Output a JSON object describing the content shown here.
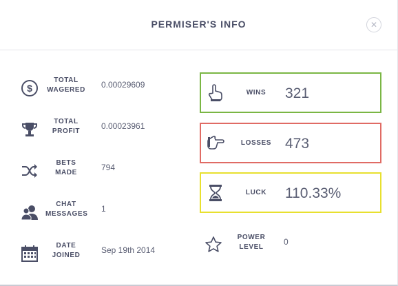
{
  "modal": {
    "title": "PERMISER'S INFO",
    "close_symbol": "✕"
  },
  "stats": [
    {
      "label": "TOTAL\nWAGERED",
      "value": "0.00029609",
      "icon": "dollar-coin-icon"
    },
    {
      "label": "TOTAL\nPROFIT",
      "value": "0.00023961",
      "icon": "trophy-icon"
    },
    {
      "label": "BETS\nMADE",
      "value": "794",
      "icon": "shuffle-icon"
    },
    {
      "label": "CHAT\nMESSAGES",
      "value": "1",
      "icon": "users-icon"
    },
    {
      "label": "DATE\nJOINED",
      "value": "Sep 19th 2014",
      "icon": "calendar-icon"
    }
  ],
  "summary": {
    "wins": {
      "label": "WINS",
      "value": "321",
      "icon": "thumbs-up-hand-icon",
      "border_color": "#7ab644"
    },
    "losses": {
      "label": "LOSSES",
      "value": "473",
      "icon": "thumbs-down-hand-icon",
      "border_color": "#e06b64"
    },
    "luck": {
      "label": "LUCK",
      "value": "110.33%",
      "icon": "hourglass-icon",
      "border_color": "#e8e02e"
    },
    "power_level": {
      "label": "POWER\nLEVEL",
      "value": "0",
      "icon": "star-icon"
    }
  }
}
